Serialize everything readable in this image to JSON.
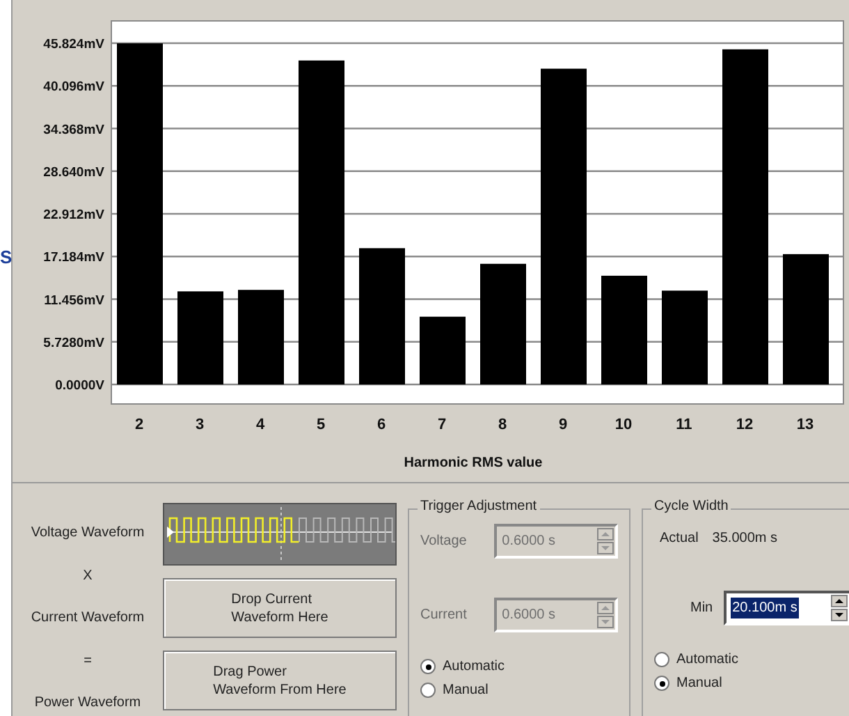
{
  "side_text": "S",
  "chart": {
    "chart_data": {
      "type": "bar",
      "xlabel": "Harmonic RMS value",
      "categories": [
        "2",
        "3",
        "4",
        "5",
        "6",
        "7",
        "8",
        "9",
        "10",
        "11",
        "12",
        "13"
      ],
      "grid": true,
      "series": [
        {
          "color": "#000000",
          "values": [
            45.8,
            12.5,
            12.7,
            43.5,
            18.3,
            9.1,
            16.2,
            42.4,
            14.6,
            12.6,
            45.0,
            17.5
          ]
        }
      ],
      "ylim": [
        0,
        45.824
      ],
      "yticks": [
        {
          "value": 0,
          "label": "0.0000V"
        },
        {
          "value": 5.728,
          "label": "5.7280mV"
        },
        {
          "value": 11.456,
          "label": "11.456mV"
        },
        {
          "value": 17.184,
          "label": "17.184mV"
        },
        {
          "value": 22.912,
          "label": "22.912mV"
        },
        {
          "value": 28.64,
          "label": "28.640mV"
        },
        {
          "value": 34.368,
          "label": "34.368mV"
        },
        {
          "value": 40.096,
          "label": "40.096mV"
        },
        {
          "value": 45.824,
          "label": "45.824mV"
        }
      ]
    }
  },
  "waveform_labels": [
    "Voltage Waveform",
    "X",
    "Current Waveform",
    "=",
    "Power Waveform"
  ],
  "drop_targets": [
    {
      "lines": [
        "Drop Current",
        "Waveform Here"
      ]
    },
    {
      "lines": [
        "Drag Power",
        "Waveform From Here"
      ]
    }
  ],
  "trigger_adjustment": {
    "title": "Trigger Adjustment",
    "fields": [
      {
        "label": "Voltage",
        "value": "0.6000 s",
        "disabled": true
      },
      {
        "label": "Current",
        "value": "0.6000 s",
        "disabled": true
      }
    ],
    "modes": [
      {
        "label": "Automatic",
        "selected": true
      },
      {
        "label": "Manual",
        "selected": false
      }
    ]
  },
  "cycle_width": {
    "title": "Cycle Width",
    "actual_label": "Actual",
    "actual_value": "35.000m s",
    "min_field": {
      "label": "Min",
      "value": "20.100m s",
      "disabled": false,
      "highlighted": true
    },
    "modes": [
      {
        "label": "Automatic",
        "selected": false
      },
      {
        "label": "Manual",
        "selected": true
      }
    ]
  }
}
